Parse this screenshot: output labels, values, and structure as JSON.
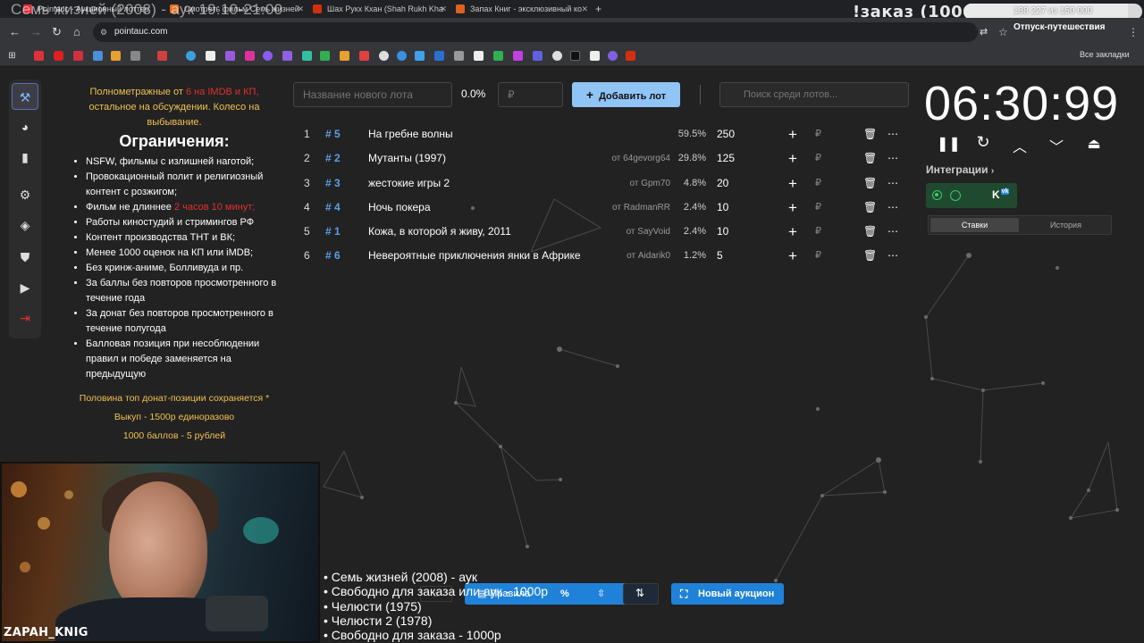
{
  "browser": {
    "tabs": [
      {
        "label": "Pointauc - Аукционный лоттер",
        "color": "#e0303a"
      },
      {
        "label": "Смотреть фильм Семь жизней",
        "color": "#e07020"
      },
      {
        "label": "Шах Рукх Кхан (Shah Rukh Kha",
        "color": "#d03010"
      },
      {
        "label": "Запах Книг - эксклюзивный ко",
        "color": "#e06020"
      }
    ],
    "new_tab": "+",
    "url": "pointauc.com",
    "all_bookmarks": "Все закладки"
  },
  "stream_overlay": {
    "title": "Семь жизней (2008) - аук 19:10-21:00",
    "order": "!заказ (1000р)",
    "progress_text": "138 227 из 150 000",
    "progress_fraction": 0.9215,
    "progress_label": "Отпуск-путешествия",
    "camera_label": "ZAPAH_KNIG",
    "queue": [
      "• Семь жизней (2008) - аук",
      "• Свободно для заказа или аук - 1000р",
      "• Челюсти (1975)",
      "• Челюсти 2 (1978)",
      "• Свободно для заказа - 1000р"
    ]
  },
  "rules": {
    "intro_prefix": "Полнометражные от ",
    "intro_red": "6 на IMDB и КП,",
    "intro_suffix": "остальное на обсуждении. Колесо на выбывание.",
    "heading": "Ограничения:",
    "items": [
      "NSFW, фильмы с излишней наготой;",
      "Провокационный полит и религиозный контент с розжигом;",
      "Фильм не длиннее ",
      "Работы киностудий и стримингов РФ",
      "Контент производства ТНТ и ВК;",
      "Менее 1000 оценок на КП или iMDB;",
      "Без кринж-аниме, Болливуда и пр.",
      "За баллы без повторов просмотренного в течение года",
      "За донат без повторов просмотренного в течение полугода",
      "Балловая позиция при несоблюдении правил и победе заменяется на предыдущую"
    ],
    "duration_red": "2 часов 10 минут;",
    "footer": [
      "Половина топ донат-позиции сохраняется *",
      "Выкуп - 1500р единоразово",
      "1000 баллов - 5 рублей"
    ]
  },
  "form": {
    "lot_placeholder": "Название нового лота",
    "percent": "0.0%",
    "amount_placeholder": "₽",
    "add_button": "Добавить лот",
    "search_placeholder": "Поиск среди лотов..."
  },
  "lots": [
    {
      "rank": "1",
      "id": "# 5",
      "title": "На гребне волны",
      "from": "",
      "pct": "59.5%",
      "value": "250"
    },
    {
      "rank": "2",
      "id": "# 2",
      "title": "Мутанты (1997)",
      "from": "от 64gevorg64",
      "pct": "29.8%",
      "value": "125"
    },
    {
      "rank": "3",
      "id": "# 3",
      "title": "жестокие игры 2",
      "from": "от Gpm70",
      "pct": "4.8%",
      "value": "20"
    },
    {
      "rank": "4",
      "id": "# 4",
      "title": "Ночь покера",
      "from": "от RadmanRR",
      "pct": "2.4%",
      "value": "10"
    },
    {
      "rank": "5",
      "id": "# 1",
      "title": "Кожа, в которой я живу, 2011",
      "from": "от SayVoid",
      "pct": "2.4%",
      "value": "10"
    },
    {
      "rank": "6",
      "id": "# 6",
      "title": "Невероятные приключения янки в Африке",
      "from": "от Aidarik0",
      "pct": "1.2%",
      "value": "5"
    }
  ],
  "lot_actions": {
    "plus": "+",
    "currency": "₽",
    "delete_icon": "🗑",
    "more": "⋯"
  },
  "timer": {
    "value": "06:30:99",
    "integrations": "Интеграции",
    "tab_bets": "Ставки",
    "tab_history": "История",
    "vk_label": "K"
  },
  "toolbar": {
    "rules_label": "Правила",
    "percent_icon": "%",
    "new_auction": "Новый аукцион"
  },
  "colors": {
    "accent": "#90c4f5",
    "primary": "#1f82d8",
    "rank_id": "#5aa0e8",
    "warning": "#f0c050",
    "danger": "#e03030"
  }
}
